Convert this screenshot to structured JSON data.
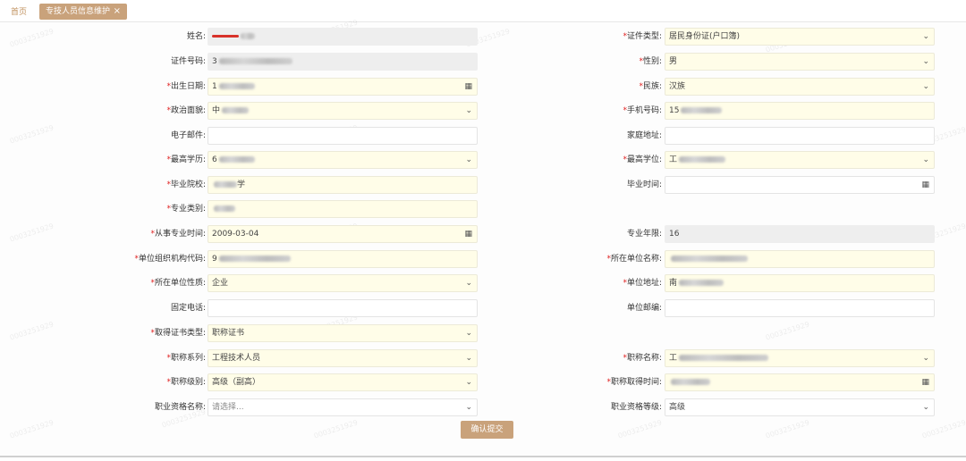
{
  "tabs": {
    "home": "首页",
    "active": "专技人员信息维护",
    "close": "×"
  },
  "watermark": "0003251929",
  "form": {
    "name_label": "姓名:",
    "id_type_label": "证件类型:",
    "id_type_value": "居民身份证(户口簿)",
    "id_number_label": "证件号码:",
    "id_number_value": "3",
    "gender_label": "性别:",
    "gender_value": "男",
    "birth_label": "出生日期:",
    "birth_value": "1",
    "ethnicity_label": "民族:",
    "ethnicity_value": "汉族",
    "politics_label": "政治面貌:",
    "politics_value": "中",
    "phone_label": "手机号码:",
    "phone_value": "15",
    "email_label": "电子邮件:",
    "home_address_label": "家庭地址:",
    "education_label": "最高学历:",
    "education_value": "6",
    "degree_label": "最高学位:",
    "degree_value": "工",
    "school_label": "毕业院校:",
    "school_value": "学",
    "grad_time_label": "毕业时间:",
    "major_category_label": "专业类别:",
    "start_work_label": "从事专业时间:",
    "start_work_value": "2009-03-04",
    "years_label": "专业年限:",
    "years_value": "16",
    "org_code_label": "单位组织机构代码:",
    "org_code_value": "9",
    "org_name_label": "所在单位名称:",
    "org_nature_label": "所在单位性质:",
    "org_nature_value": "企业",
    "org_address_label": "单位地址:",
    "org_address_value": "南",
    "landline_label": "固定电话:",
    "postcode_label": "单位邮编:",
    "cert_type_label": "取得证书类型:",
    "cert_type_value": "职称证书",
    "title_series_label": "职称系列:",
    "title_series_value": "工程技术人员",
    "title_name_label": "职称名称:",
    "title_name_value": "工",
    "title_level_label": "职称级别:",
    "title_level_value": "高级（副高）",
    "title_time_label": "职称取得时间:",
    "qual_name_label": "职业资格名称:",
    "qual_name_placeholder": "请选择...",
    "qual_level_label": "职业资格等级:",
    "qual_level_value": "高级",
    "required_mark": "*",
    "select_arrow": "⌄",
    "calendar_glyph": "▦"
  },
  "submit_label": "确认提交",
  "colors": {
    "accent": "#c9a27b",
    "required_bg": "#fffde8",
    "readonly_bg": "#eeeeee",
    "required_star": "#e02020"
  }
}
